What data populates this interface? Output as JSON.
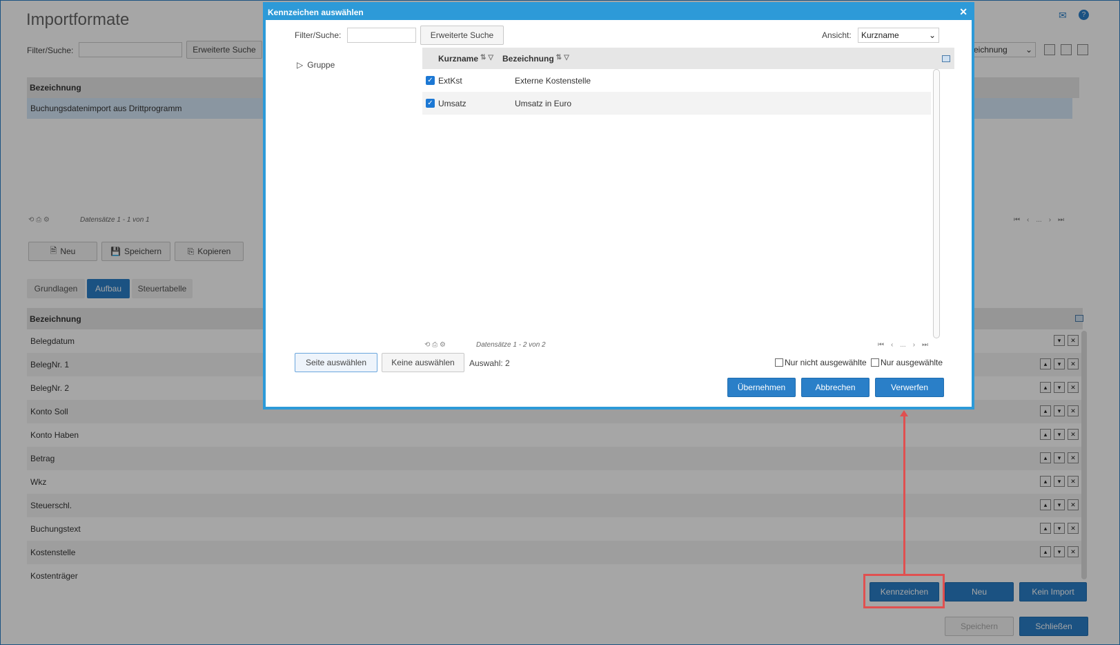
{
  "page": {
    "title": "Importformate",
    "filter_label": "Filter/Suche:",
    "extended_search": "Erweiterte Suche",
    "view_select_value": "eichnung",
    "grid_header": "Bezeichnung",
    "grid_row": "Buchungsdatenimport aus Drittprogramm",
    "records": "Datensätze 1 - 1 von 1",
    "pager_ellipsis": "...",
    "btn_new": "Neu",
    "btn_save": "Speichern",
    "btn_copy": "Kopieren",
    "tabs": [
      "Grundlagen",
      "Aufbau",
      "Steuertabelle"
    ],
    "lower_header": "Bezeichnung",
    "lower_rows": [
      "Belegdatum",
      "BelegNr. 1",
      "BelegNr. 2",
      "Konto Soll",
      "Konto Haben",
      "Betrag",
      "Wkz",
      "Steuerschl.",
      "Buchungstext",
      "Kostenstelle",
      "Kostenträger"
    ],
    "btn_kennzeichen": "Kennzeichen",
    "btn_neu2": "Neu",
    "btn_kein_import": "Kein Import",
    "btn_speichern2": "Speichern",
    "btn_schliessen": "Schließen"
  },
  "modal": {
    "title": "Kennzeichen auswählen",
    "filter_label": "Filter/Suche:",
    "extended_search": "Erweiterte Suche",
    "view_label": "Ansicht:",
    "view_value": "Kurzname",
    "tree_item": "Gruppe",
    "col1": "Kurzname",
    "col2": "Bezeichnung",
    "rows": [
      {
        "short": "ExtKst",
        "desc": "Externe Kostenstelle"
      },
      {
        "short": "Umsatz",
        "desc": "Umsatz in Euro"
      }
    ],
    "records": "Datensätze 1 - 2 von 2",
    "pager_ellipsis": "...",
    "btn_select_page": "Seite auswählen",
    "btn_select_none": "Keine auswählen",
    "selection": "Auswahl: 2",
    "only_unselected": "Nur nicht ausgewählte",
    "only_selected": "Nur ausgewählte",
    "btn_apply": "Übernehmen",
    "btn_cancel": "Abbrechen",
    "btn_discard": "Verwerfen"
  }
}
